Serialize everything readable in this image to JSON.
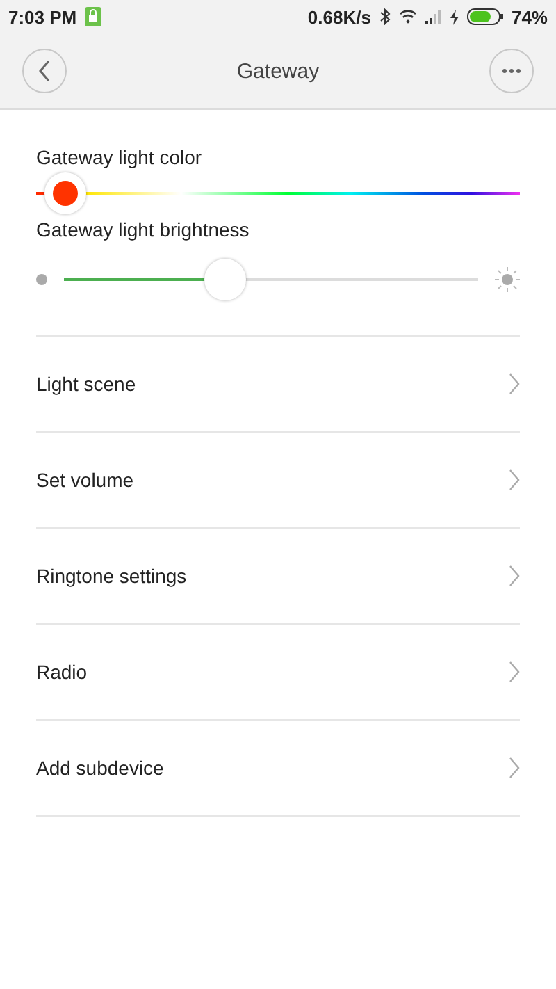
{
  "status_bar": {
    "time": "7:03 PM",
    "speed": "0.68K/s",
    "battery": "74%"
  },
  "header": {
    "title": "Gateway"
  },
  "color_slider": {
    "label": "Gateway light color",
    "level": 0.06,
    "color": "#ff3300"
  },
  "brightness_slider": {
    "label": "Gateway light brightness",
    "level": 0.39
  },
  "menu": [
    {
      "label": "Light scene"
    },
    {
      "label": "Set volume"
    },
    {
      "label": "Ringtone settings"
    },
    {
      "label": "Radio"
    },
    {
      "label": "Add subdevice"
    }
  ]
}
